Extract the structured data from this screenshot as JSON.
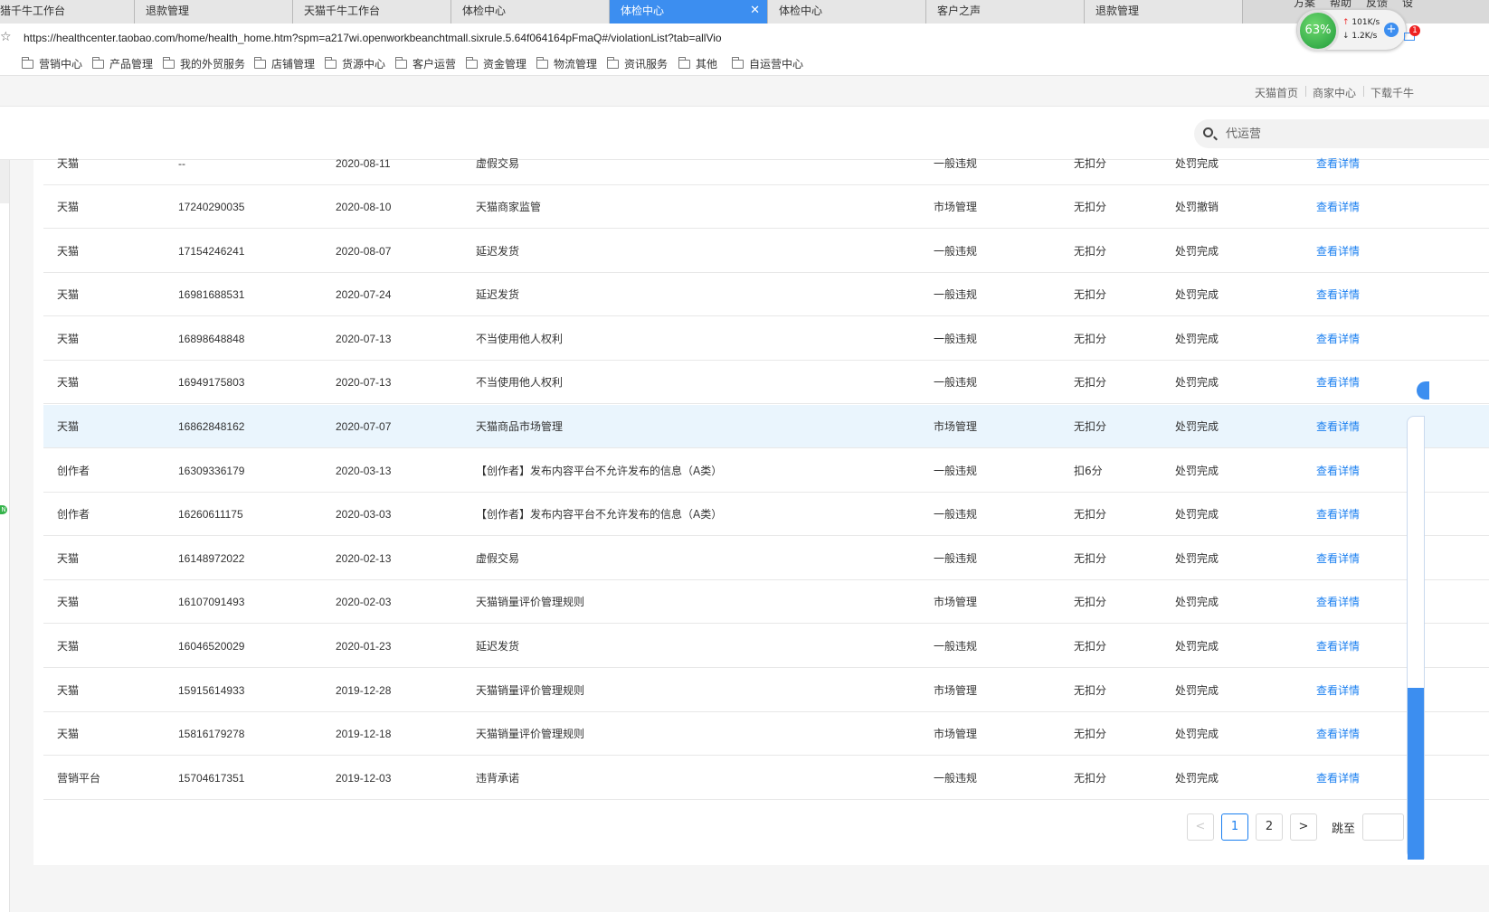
{
  "tabs": [
    {
      "label": "猎千牛工作台",
      "active": false
    },
    {
      "label": "退款管理",
      "active": false
    },
    {
      "label": "天猫千牛工作台",
      "active": false
    },
    {
      "label": "体检中心",
      "active": false
    },
    {
      "label": "体检中心",
      "active": true
    },
    {
      "label": "体检中心",
      "active": false
    },
    {
      "label": "客户之声",
      "active": false
    },
    {
      "label": "退款管理",
      "active": false
    }
  ],
  "address": {
    "url": "https://healthcenter.taobao.com/home/health_home.htm?spm=a217wi.openworkbeanchtmall.sixrule.5.64f064164pFmaQ#/violationList?tab=allVio"
  },
  "bookmarks": [
    "营销中心",
    "产品管理",
    "我的外贸服务",
    "店铺管理",
    "货源中心",
    "客户运营",
    "资金管理",
    "物流管理",
    "资讯服务",
    "其他",
    "自运营中心"
  ],
  "speed_widget": {
    "percent": "63%",
    "upload": "101K/s",
    "download": "1.2K/s",
    "notification_count": "1"
  },
  "top_menu": [
    "方案",
    "帮助",
    "反馈",
    "设"
  ],
  "header_links": [
    "天猫首页",
    "商家中心",
    "下载千牛"
  ],
  "search": {
    "placeholder": "代运营"
  },
  "left_badge": "N",
  "table": {
    "partial_top_row": {
      "source": "天猫",
      "id": "--",
      "date": "2020-08-11",
      "reason": "虚假交易",
      "type": "一般违规",
      "score": "无扣分",
      "status": "处罚完成",
      "action": "查看详情"
    },
    "rows": [
      {
        "source": "天猫",
        "id": "17240290035",
        "date": "2020-08-10",
        "reason": "天猫商家监管",
        "type": "市场管理",
        "score": "无扣分",
        "status": "处罚撤销",
        "action": "查看详情"
      },
      {
        "source": "天猫",
        "id": "17154246241",
        "date": "2020-08-07",
        "reason": "延迟发货",
        "type": "一般违规",
        "score": "无扣分",
        "status": "处罚完成",
        "action": "查看详情"
      },
      {
        "source": "天猫",
        "id": "16981688531",
        "date": "2020-07-24",
        "reason": "延迟发货",
        "type": "一般违规",
        "score": "无扣分",
        "status": "处罚完成",
        "action": "查看详情"
      },
      {
        "source": "天猫",
        "id": "16898648848",
        "date": "2020-07-13",
        "reason": "不当使用他人权利",
        "type": "一般违规",
        "score": "无扣分",
        "status": "处罚完成",
        "action": "查看详情"
      },
      {
        "source": "天猫",
        "id": "16949175803",
        "date": "2020-07-13",
        "reason": "不当使用他人权利",
        "type": "一般违规",
        "score": "无扣分",
        "status": "处罚完成",
        "action": "查看详情"
      },
      {
        "source": "天猫",
        "id": "16862848162",
        "date": "2020-07-07",
        "reason": "天猫商品市场管理",
        "type": "市场管理",
        "score": "无扣分",
        "status": "处罚完成",
        "action": "查看详情",
        "highlighted": true
      },
      {
        "source": "创作者",
        "id": "16309336179",
        "date": "2020-03-13",
        "reason": "【创作者】发布内容平台不允许发布的信息（A类）",
        "type": "一般违规",
        "score": "扣6分",
        "status": "处罚完成",
        "action": "查看详情"
      },
      {
        "source": "创作者",
        "id": "16260611175",
        "date": "2020-03-03",
        "reason": "【创作者】发布内容平台不允许发布的信息（A类）",
        "type": "一般违规",
        "score": "无扣分",
        "status": "处罚完成",
        "action": "查看详情"
      },
      {
        "source": "天猫",
        "id": "16148972022",
        "date": "2020-02-13",
        "reason": "虚假交易",
        "type": "一般违规",
        "score": "无扣分",
        "status": "处罚完成",
        "action": "查看详情"
      },
      {
        "source": "天猫",
        "id": "16107091493",
        "date": "2020-02-03",
        "reason": "天猫销量评价管理规则",
        "type": "市场管理",
        "score": "无扣分",
        "status": "处罚完成",
        "action": "查看详情"
      },
      {
        "source": "天猫",
        "id": "16046520029",
        "date": "2020-01-23",
        "reason": "延迟发货",
        "type": "一般违规",
        "score": "无扣分",
        "status": "处罚完成",
        "action": "查看详情"
      },
      {
        "source": "天猫",
        "id": "15915614933",
        "date": "2019-12-28",
        "reason": "天猫销量评价管理规则",
        "type": "市场管理",
        "score": "无扣分",
        "status": "处罚完成",
        "action": "查看详情"
      },
      {
        "source": "天猫",
        "id": "15816179278",
        "date": "2019-12-18",
        "reason": "天猫销量评价管理规则",
        "type": "市场管理",
        "score": "无扣分",
        "status": "处罚完成",
        "action": "查看详情"
      },
      {
        "source": "营销平台",
        "id": "15704617351",
        "date": "2019-12-03",
        "reason": "违背承诺",
        "type": "一般违规",
        "score": "无扣分",
        "status": "处罚完成",
        "action": "查看详情"
      }
    ]
  },
  "pagination": {
    "prev": "<",
    "pages": [
      "1",
      "2"
    ],
    "current": "1",
    "next": ">",
    "jump_label": "跳至"
  },
  "colors": {
    "accent": "#1a7ff0",
    "tab_active": "#3c8ef0",
    "row_highlight": "#eaf5fd"
  }
}
